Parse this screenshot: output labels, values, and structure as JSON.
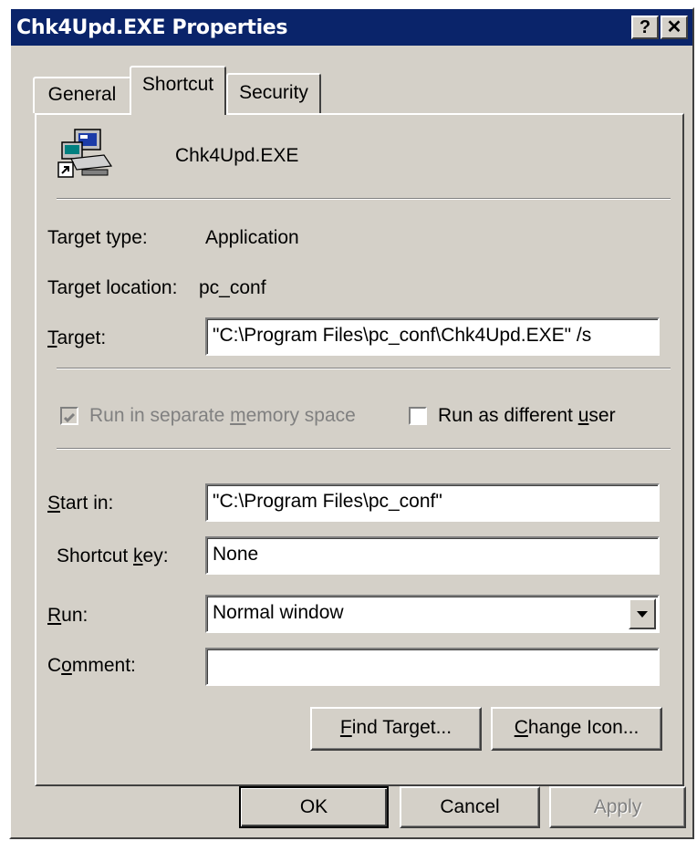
{
  "window": {
    "title": "Chk4Upd.EXE Properties"
  },
  "titlebar": {
    "help_label": "?",
    "close_label": "✕"
  },
  "tabs": [
    {
      "label": "General"
    },
    {
      "label": "Shortcut"
    },
    {
      "label": "Security"
    }
  ],
  "header": {
    "filename": "Chk4Upd.EXE",
    "icon": "shortcut-application-icon"
  },
  "info": {
    "target_type_label": "Target type:",
    "target_type_value": "Application",
    "target_location_label": "Target location:",
    "target_location_value": "pc_conf"
  },
  "target": {
    "label_accel": "T",
    "label_rest": "arget:",
    "value": "\"C:\\Program Files\\pc_conf\\Chk4Upd.EXE\" /s"
  },
  "options": {
    "separate_memory": {
      "pre": "Run in separate ",
      "accel": "m",
      "post": "emory space",
      "checked": true,
      "disabled": true
    },
    "different_user": {
      "pre": "Run as different ",
      "accel": "u",
      "post": "ser",
      "checked": false
    }
  },
  "start_in": {
    "label_accel": "S",
    "label_rest": "tart in:",
    "value": "\"C:\\Program Files\\pc_conf\""
  },
  "shortcut_key": {
    "label_pre": "Shortcut ",
    "label_accel": "k",
    "label_post": "ey:",
    "value": "None"
  },
  "run": {
    "label_accel": "R",
    "label_rest": "un:",
    "value": "Normal window"
  },
  "comment": {
    "label_pre": "C",
    "label_accel": "o",
    "label_post": "mment:",
    "value": ""
  },
  "actions": {
    "find_target": {
      "accel": "F",
      "rest": "ind Target..."
    },
    "change_icon": {
      "accel": "C",
      "rest": "hange Icon..."
    }
  },
  "footer": {
    "ok": "OK",
    "cancel": "Cancel",
    "apply": "Apply"
  },
  "colors": {
    "titlebar": "#0a246a",
    "face": "#d4d0c8",
    "disabled_text": "#808080"
  }
}
